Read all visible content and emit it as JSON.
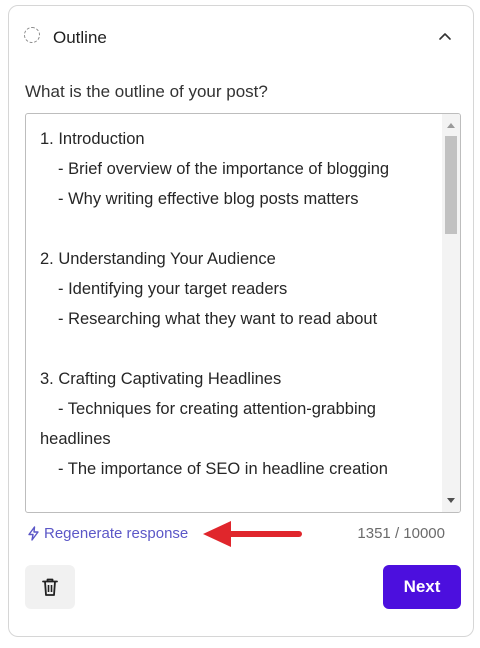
{
  "header": {
    "title": "Outline",
    "status_icon": "dashed-circle-icon",
    "collapse_icon": "chevron-up-icon"
  },
  "question": "What is the outline of your post?",
  "outline": {
    "lines": [
      {
        "text": "1. Introduction",
        "indent": false
      },
      {
        "text": "- Brief overview of the importance of blogging",
        "indent": true
      },
      {
        "text": "- Why writing effective blog posts matters",
        "indent": true
      },
      {
        "text": "",
        "indent": false
      },
      {
        "text": "2. Understanding Your Audience",
        "indent": false
      },
      {
        "text": "- Identifying your target readers",
        "indent": true
      },
      {
        "text": "- Researching what they want to read about",
        "indent": true
      },
      {
        "text": "",
        "indent": false
      },
      {
        "text": "3. Crafting Captivating Headlines",
        "indent": false
      },
      {
        "text": "- Techniques for creating attention-grabbing",
        "indent": true
      },
      {
        "text": "headlines",
        "indent": false
      },
      {
        "text": "- The importance of SEO in headline creation",
        "indent": true
      }
    ]
  },
  "footer": {
    "regenerate_label": "Regenerate response",
    "regenerate_icon": "lightning-bolt-icon",
    "char_count": "1351 / 10000",
    "delete_icon": "trash-icon",
    "next_label": "Next"
  },
  "colors": {
    "accent": "#4c0fde",
    "link": "#5b57c7",
    "arrow": "#e0262c"
  }
}
